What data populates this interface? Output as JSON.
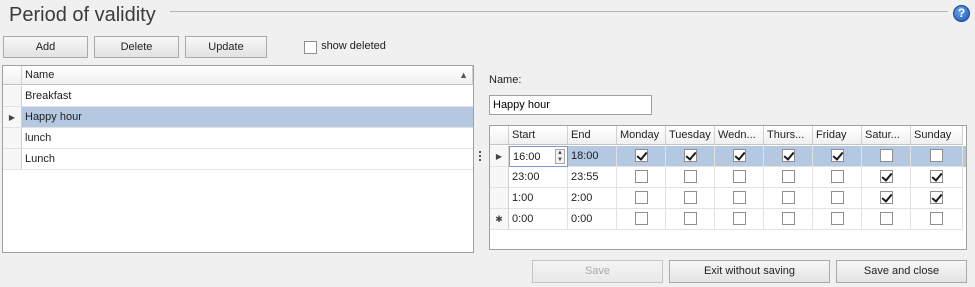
{
  "page": {
    "title": "Period of validity",
    "help_glyph": "?"
  },
  "toolbar": {
    "add": "Add",
    "delete": "Delete",
    "update": "Update",
    "show_deleted": "show deleted"
  },
  "list": {
    "header": "Name",
    "items": [
      "Breakfast",
      "Happy hour",
      "lunch",
      "Lunch"
    ],
    "selected_index": 1
  },
  "detail": {
    "name_label": "Name:",
    "name_value": "Happy hour",
    "columns": [
      "Start",
      "End",
      "Monday",
      "Tuesday",
      "Wedn...",
      "Thurs...",
      "Friday",
      "Satur...",
      "Sunday"
    ],
    "rows": [
      {
        "start": "16:00",
        "end": "18:00",
        "days": [
          true,
          true,
          true,
          true,
          true,
          false,
          false
        ],
        "current": true
      },
      {
        "start": "23:00",
        "end": "23:55",
        "days": [
          false,
          false,
          false,
          false,
          false,
          true,
          true
        ]
      },
      {
        "start": "1:00",
        "end": "2:00",
        "days": [
          false,
          false,
          false,
          false,
          false,
          true,
          true
        ]
      },
      {
        "start": "0:00",
        "end": "0:00",
        "days": [
          false,
          false,
          false,
          false,
          false,
          false,
          false
        ],
        "new_row": true
      }
    ]
  },
  "footer": {
    "save": "Save",
    "exit": "Exit without saving",
    "save_close": "Save and close"
  },
  "colors": {
    "selection": "#b4c8e2",
    "help_icon": "#1d57b2"
  }
}
